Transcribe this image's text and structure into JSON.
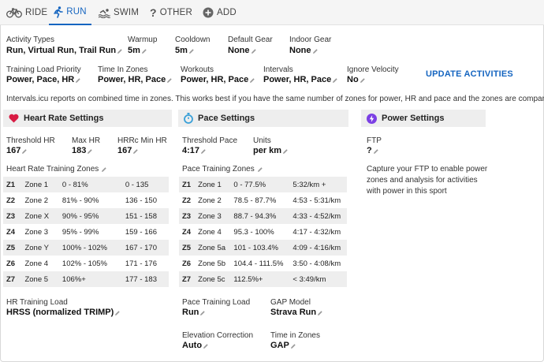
{
  "tabs": [
    {
      "label": "RIDE"
    },
    {
      "label": "RUN"
    },
    {
      "label": "SWIM"
    },
    {
      "label": "OTHER"
    },
    {
      "label": "ADD"
    }
  ],
  "settings": {
    "activity_types": {
      "label": "Activity Types",
      "value": "Run, Virtual Run, Trail Run"
    },
    "warmup": {
      "label": "Warmup",
      "value": "5m"
    },
    "cooldown": {
      "label": "Cooldown",
      "value": "5m"
    },
    "default_gear": {
      "label": "Default Gear",
      "value": "None"
    },
    "indoor_gear": {
      "label": "Indoor Gear",
      "value": "None"
    },
    "training_load_priority": {
      "label": "Training Load Priority",
      "value": "Power, Pace, HR"
    },
    "time_in_zones": {
      "label": "Time In Zones",
      "value": "Power, HR, Pace"
    },
    "workouts": {
      "label": "Workouts",
      "value": "Power, HR, Pace"
    },
    "intervals": {
      "label": "Intervals",
      "value": "Power, HR, Pace"
    },
    "ignore_velocity": {
      "label": "Ignore Velocity",
      "value": "No"
    },
    "update_button": "UPDATE ACTIVITIES",
    "note": "Intervals.icu reports on combined time in zones. This works best if you have the same number of zones for power, HR and pace and the zones are comparable."
  },
  "heart_rate": {
    "title": "Heart Rate Settings",
    "threshold": {
      "label": "Threshold HR",
      "value": "167"
    },
    "max": {
      "label": "Max HR",
      "value": "183"
    },
    "hrrc_min": {
      "label": "HRRc Min HR",
      "value": "167"
    },
    "zones_title": "Heart Rate Training Zones",
    "zones": [
      {
        "z": "Z1",
        "name": "Zone 1",
        "pct": "0 - 81%",
        "range": "0 - 135"
      },
      {
        "z": "Z2",
        "name": "Zone 2",
        "pct": "81% - 90%",
        "range": "136 - 150"
      },
      {
        "z": "Z3",
        "name": "Zone X",
        "pct": "90% - 95%",
        "range": "151 - 158"
      },
      {
        "z": "Z4",
        "name": "Zone 3",
        "pct": "95% - 99%",
        "range": "159 - 166"
      },
      {
        "z": "Z5",
        "name": "Zone Y",
        "pct": "100% - 102%",
        "range": "167 - 170"
      },
      {
        "z": "Z6",
        "name": "Zone 4",
        "pct": "102% - 105%",
        "range": "171 - 176"
      },
      {
        "z": "Z7",
        "name": "Zone 5",
        "pct": "106%+",
        "range": "177 - 183"
      }
    ],
    "training_load": {
      "label": "HR Training Load",
      "value": "HRSS (normalized TRIMP)"
    }
  },
  "pace": {
    "title": "Pace Settings",
    "threshold": {
      "label": "Threshold Pace",
      "value": "4:17"
    },
    "units": {
      "label": "Units",
      "value": "per km"
    },
    "zones_title": "Pace Training Zones",
    "zones": [
      {
        "z": "Z1",
        "name": "Zone 1",
        "pct": "0 - 77.5%",
        "range": "5:32/km +"
      },
      {
        "z": "Z2",
        "name": "Zone 2",
        "pct": "78.5 - 87.7%",
        "range": "4:53 - 5:31/km"
      },
      {
        "z": "Z3",
        "name": "Zone 3",
        "pct": "88.7 - 94.3%",
        "range": "4:33 - 4:52/km"
      },
      {
        "z": "Z4",
        "name": "Zone 4",
        "pct": "95.3 - 100%",
        "range": "4:17 - 4:32/km"
      },
      {
        "z": "Z5",
        "name": "Zone 5a",
        "pct": "101 - 103.4%",
        "range": "4:09 - 4:16/km"
      },
      {
        "z": "Z6",
        "name": "Zone 5b",
        "pct": "104.4 - 111.5%",
        "range": "3:50 - 4:08/km"
      },
      {
        "z": "Z7",
        "name": "Zone 5c",
        "pct": "112.5%+",
        "range": "< 3:49/km"
      }
    ],
    "training_load": {
      "label": "Pace Training Load",
      "value": "Run"
    },
    "gap_model": {
      "label": "GAP Model",
      "value": "Strava Run"
    },
    "elevation_correction": {
      "label": "Elevation Correction",
      "value": "Auto"
    },
    "time_in_zones": {
      "label": "Time in Zones",
      "value": "GAP"
    }
  },
  "power": {
    "title": "Power Settings",
    "ftp": {
      "label": "FTP",
      "value": "?"
    },
    "description": "Capture your FTP to enable power zones and analysis for activities with power in this sport"
  },
  "colors": {
    "accent": "#1565c0",
    "heart": "#d81b43",
    "watch": "#3aa0d8",
    "power": "#7b3fe4"
  }
}
